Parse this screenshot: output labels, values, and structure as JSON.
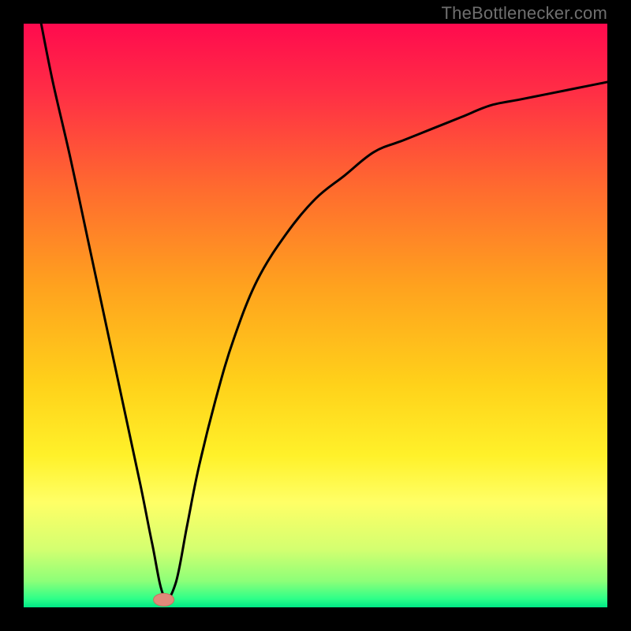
{
  "watermark": "TheBottlenecker.com",
  "colors": {
    "frame": "#000000",
    "curve": "#000000",
    "marker_fill": "#e08a7a",
    "marker_stroke": "#c8705f",
    "gradient_stops": [
      {
        "offset": 0.0,
        "color": "#ff0a4e"
      },
      {
        "offset": 0.12,
        "color": "#ff2f45"
      },
      {
        "offset": 0.28,
        "color": "#ff6a2f"
      },
      {
        "offset": 0.45,
        "color": "#ffa21e"
      },
      {
        "offset": 0.62,
        "color": "#ffd21a"
      },
      {
        "offset": 0.74,
        "color": "#fff12a"
      },
      {
        "offset": 0.82,
        "color": "#ffff66"
      },
      {
        "offset": 0.9,
        "color": "#d4ff70"
      },
      {
        "offset": 0.955,
        "color": "#8dff78"
      },
      {
        "offset": 0.985,
        "color": "#2fff88"
      },
      {
        "offset": 1.0,
        "color": "#00e886"
      }
    ]
  },
  "chart_data": {
    "type": "line",
    "xlabel": "",
    "ylabel": "",
    "xlim": [
      0,
      100
    ],
    "ylim": [
      0,
      100
    ],
    "title": "",
    "notes": "Axes unlabeled; values estimated from pixel positions. y=0 at bottom (green), y=100 at top (red). Curve descends steeply from upper-left down to near zero around x≈24, then rises asymptotically toward ~90 at the right edge.",
    "series": [
      {
        "name": "bottleneck-curve",
        "x": [
          3,
          5,
          8,
          11,
          14,
          17,
          20,
          22,
          24,
          26,
          28,
          30,
          33,
          36,
          40,
          45,
          50,
          55,
          60,
          65,
          70,
          75,
          80,
          85,
          90,
          95,
          100
        ],
        "y": [
          100,
          90,
          77,
          63,
          49,
          35,
          21,
          11,
          2,
          4,
          14,
          24,
          36,
          46,
          56,
          64,
          70,
          74,
          78,
          80,
          82,
          84,
          86,
          87,
          88,
          89,
          90
        ]
      }
    ],
    "markers": [
      {
        "name": "optimal-point",
        "x": 24,
        "y": 1.3
      }
    ]
  }
}
